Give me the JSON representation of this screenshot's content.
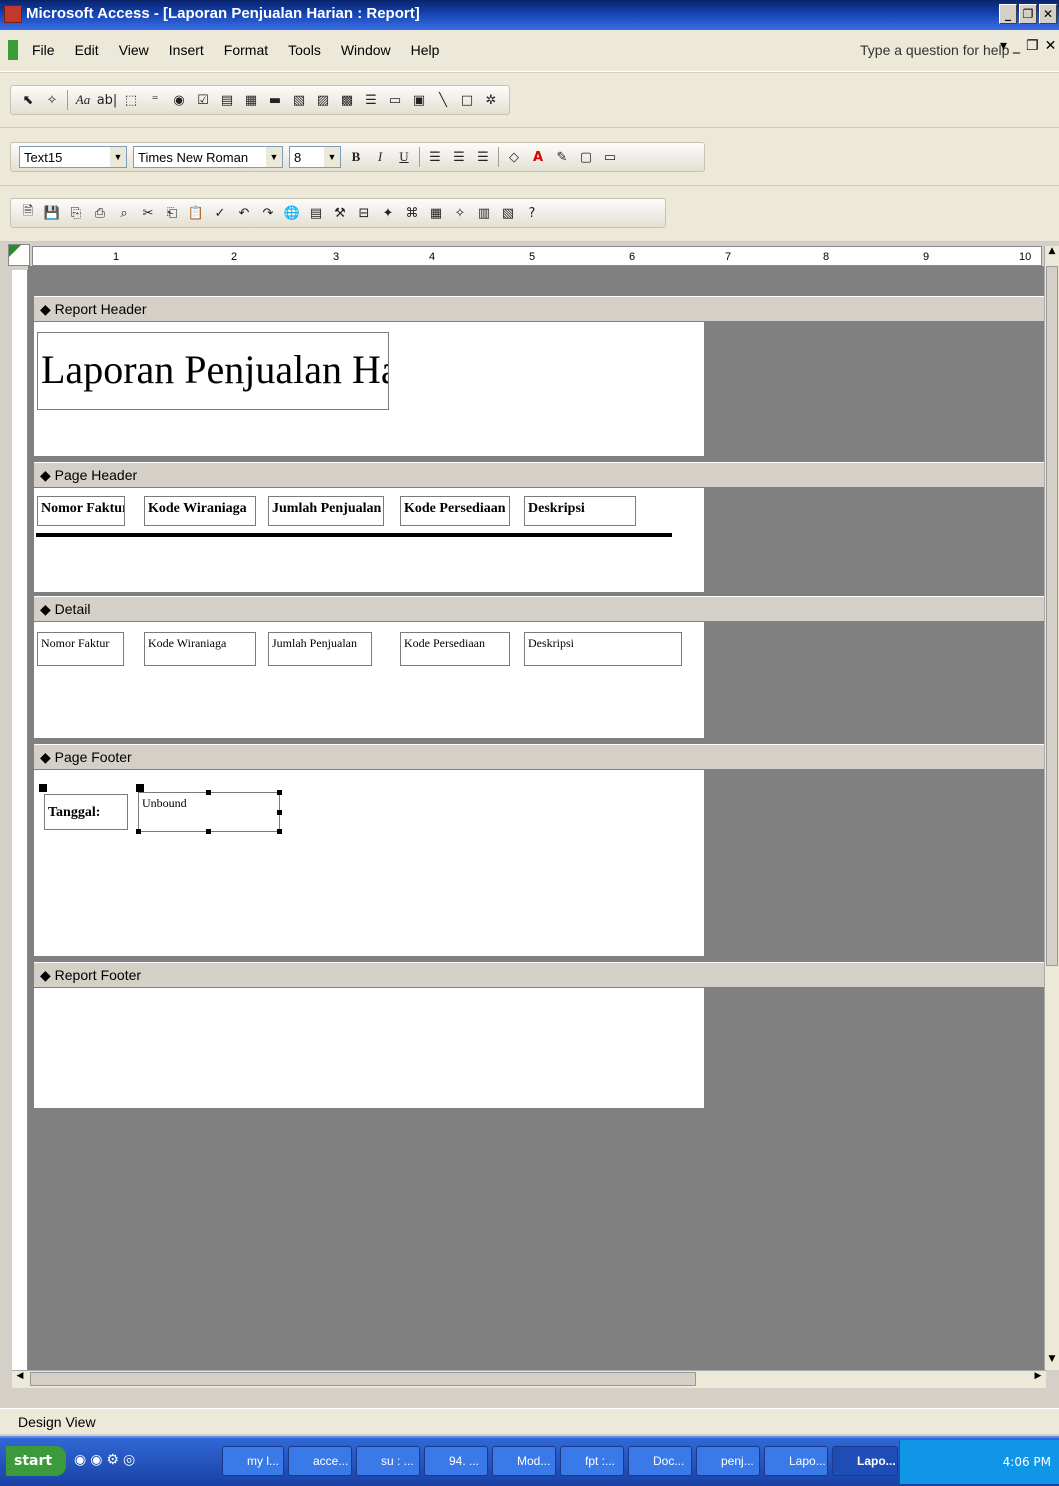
{
  "window": {
    "title": "Microsoft Access - [Laporan Penjualan Harian : Report]"
  },
  "menu": {
    "items": [
      "File",
      "Edit",
      "View",
      "Insert",
      "Format",
      "Tools",
      "Window",
      "Help"
    ],
    "help_placeholder": "Type a question for help"
  },
  "format_toolbar": {
    "object": "Text15",
    "font": "Times New Roman",
    "size": "8",
    "bold": "B",
    "italic": "I",
    "underline": "U"
  },
  "ruler": {
    "ticks": [
      "1",
      "2",
      "3",
      "4",
      "5",
      "6",
      "7",
      "8",
      "9",
      "10"
    ]
  },
  "sections": {
    "report_header": "Report Header",
    "page_header": "Page Header",
    "detail": "Detail",
    "page_footer": "Page Footer",
    "report_footer": "Report Footer"
  },
  "report": {
    "title": "Laporan Penjualan Harian",
    "columns": [
      "Nomor Faktur",
      "Kode Wiraniaga",
      "Jumlah Penjualan",
      "Kode Persediaan",
      "Deskripsi"
    ],
    "detail_fields": [
      "Nomor Faktur",
      "Kode Wiraniaga",
      "Jumlah Penjualan",
      "Kode Persediaan",
      "Deskripsi"
    ],
    "footer_label": "Tanggal:",
    "footer_field": "Unbound"
  },
  "status": {
    "text": "Design View"
  },
  "taskbar": {
    "start": "start",
    "tasks": [
      "my l...",
      "acce...",
      "su : ...",
      "94. ...",
      "Mod...",
      "fpt :...",
      "Doc...",
      "penj...",
      "Lapo...",
      "Lapo..."
    ],
    "clock": "4:06 PM"
  }
}
